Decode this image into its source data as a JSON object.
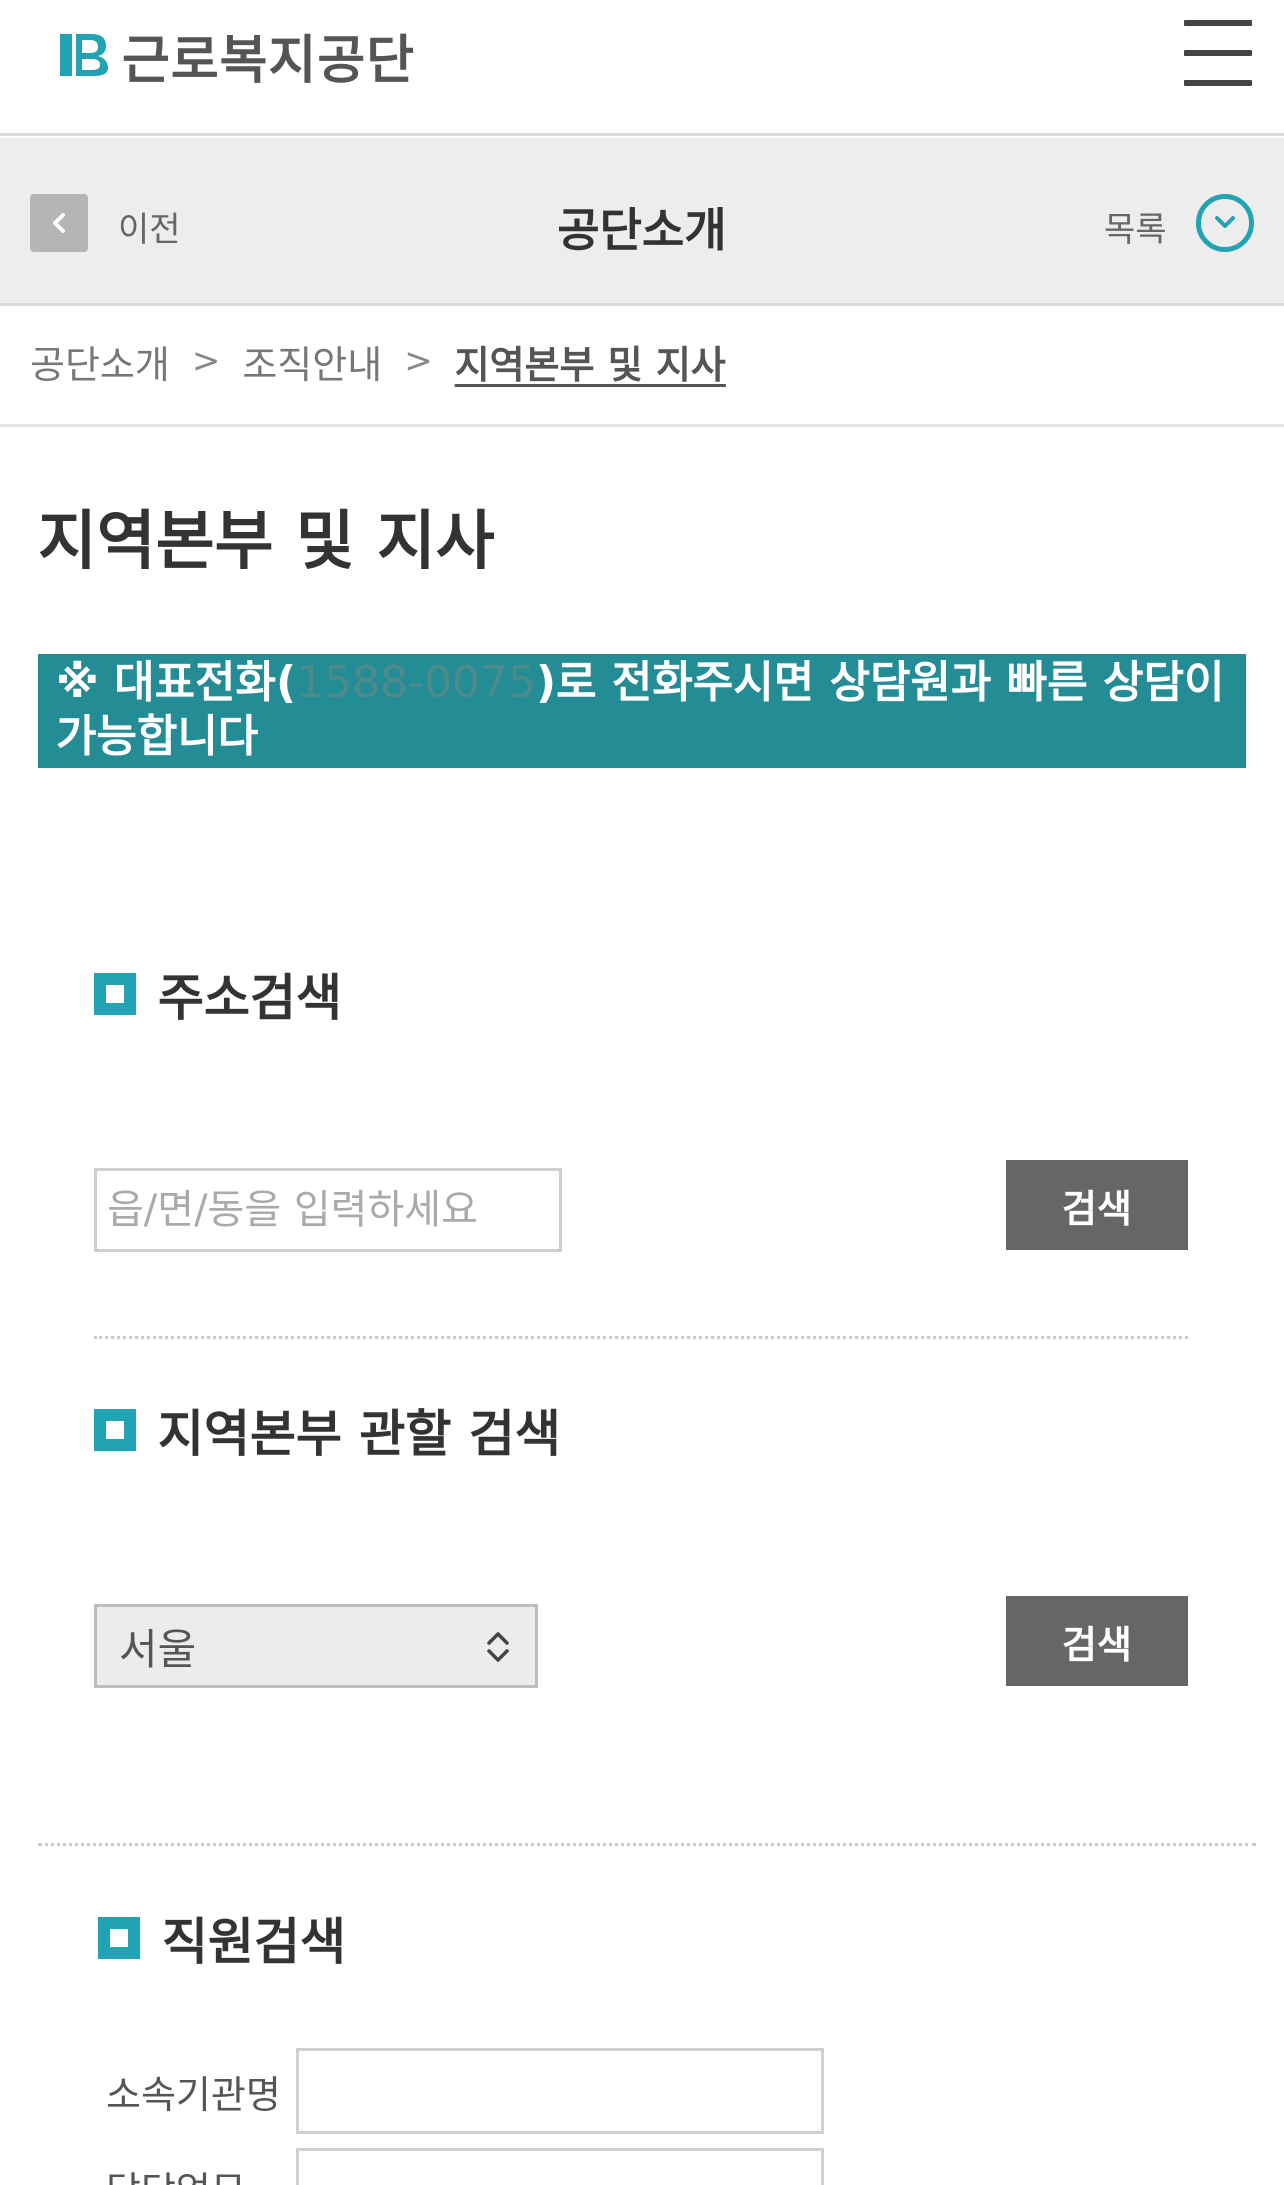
{
  "header": {
    "logo_text": "근로복지공단",
    "brand_color": "#22a3b3"
  },
  "subnav": {
    "back_label": "이전",
    "title": "공단소개",
    "list_label": "목록"
  },
  "breadcrumb": {
    "items": [
      "공단소개",
      "조직안내",
      "지역본부 및 지사"
    ],
    "separator": ">"
  },
  "page": {
    "title": "지역본부 및 지사"
  },
  "notice": {
    "prefix": "※ 대표전화(",
    "phone": "1588-0075",
    "suffix": ")로 전화주시면 상담원과 빠른 상담이 가능합니다",
    "bg_color": "#238c95"
  },
  "address_search": {
    "heading": "주소검색",
    "placeholder": "읍/면/동을 입력하세요",
    "button_label": "검색"
  },
  "region_search": {
    "heading": "지역본부 관할 검색",
    "selected": "서울",
    "button_label": "검색"
  },
  "staff_search": {
    "heading": "직원검색",
    "field1_label": "소속기관명",
    "field2_label": "담당업무"
  }
}
